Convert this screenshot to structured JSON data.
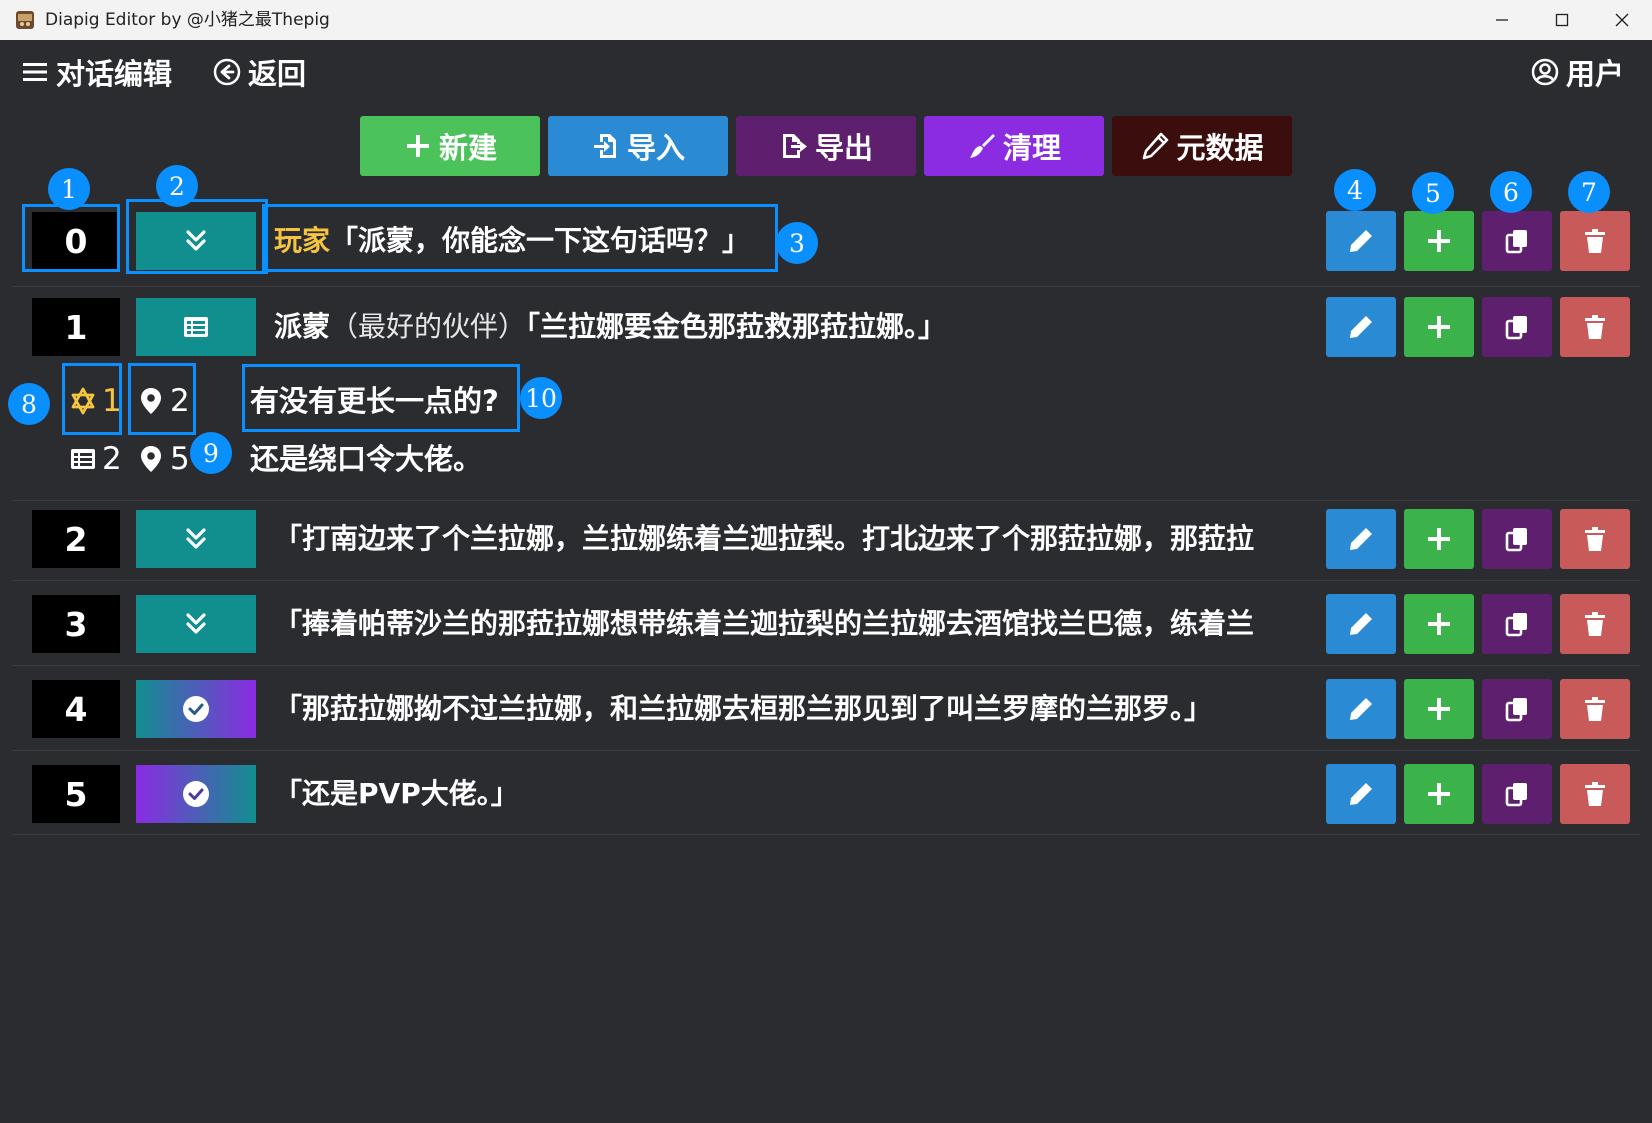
{
  "window": {
    "title": "Diapig Editor by @小猪之最Thepig"
  },
  "topnav": {
    "menu_label": "对话编辑",
    "back_label": "返回",
    "user_label": "用户"
  },
  "toolbar": {
    "new_label": "新建",
    "import_label": "导入",
    "export_label": "导出",
    "clean_label": "清理",
    "meta_label": "元数据"
  },
  "colors": {
    "new": "#4cc25a",
    "import": "#2a8ad4",
    "export": "#5d1f6e",
    "clean": "#8b2be2",
    "meta": "#3b0d0d",
    "toggle_teal": "#118f8f",
    "speaker_highlight": "#f5c542"
  },
  "rows": [
    {
      "index": "0",
      "toggle": "chevron-double-down-icon",
      "speaker": "玩家",
      "subtitle": "",
      "text": "「派蒙，你能念一下这句话吗？」"
    },
    {
      "index": "1",
      "toggle": "list-icon",
      "speaker": "派蒙",
      "subtitle": "（最好的伙伴）",
      "text": "「兰拉娜要金色那菈救那菈拉娜。」"
    },
    {
      "index": "2",
      "toggle": "chevron-double-down-icon",
      "speaker": "",
      "subtitle": "",
      "text": "「打南边来了个兰拉娜，兰拉娜练着兰迦拉梨。打北边来了个那菈拉娜，那菈拉"
    },
    {
      "index": "3",
      "toggle": "chevron-double-down-icon",
      "speaker": "",
      "subtitle": "",
      "text": "「捧着帕蒂沙兰的那菈拉娜想带练着兰迦拉梨的兰拉娜去酒馆找兰巴德，练着兰"
    },
    {
      "index": "4",
      "toggle": "check-circle-icon",
      "speaker": "",
      "subtitle": "",
      "text": "「那菈拉娜拗不过兰拉娜，和兰拉娜去桓那兰那见到了叫兰罗摩的兰那罗。」"
    },
    {
      "index": "5",
      "toggle": "check-circle-icon",
      "speaker": "",
      "subtitle": "",
      "text": "「还是PVP大佬。」"
    }
  ],
  "options": [
    {
      "icon1": "star-of-david-icon",
      "value1": "1",
      "icon2": "map-marker-icon",
      "value2": "2",
      "text": "有没有更长一点的?"
    },
    {
      "icon1": "list-icon",
      "value1": "2",
      "icon2": "map-marker-icon",
      "value2": "5",
      "text": "还是绕口令大佬。"
    }
  ],
  "markers": [
    "1",
    "2",
    "3",
    "4",
    "5",
    "6",
    "7",
    "8",
    "9",
    "10"
  ]
}
